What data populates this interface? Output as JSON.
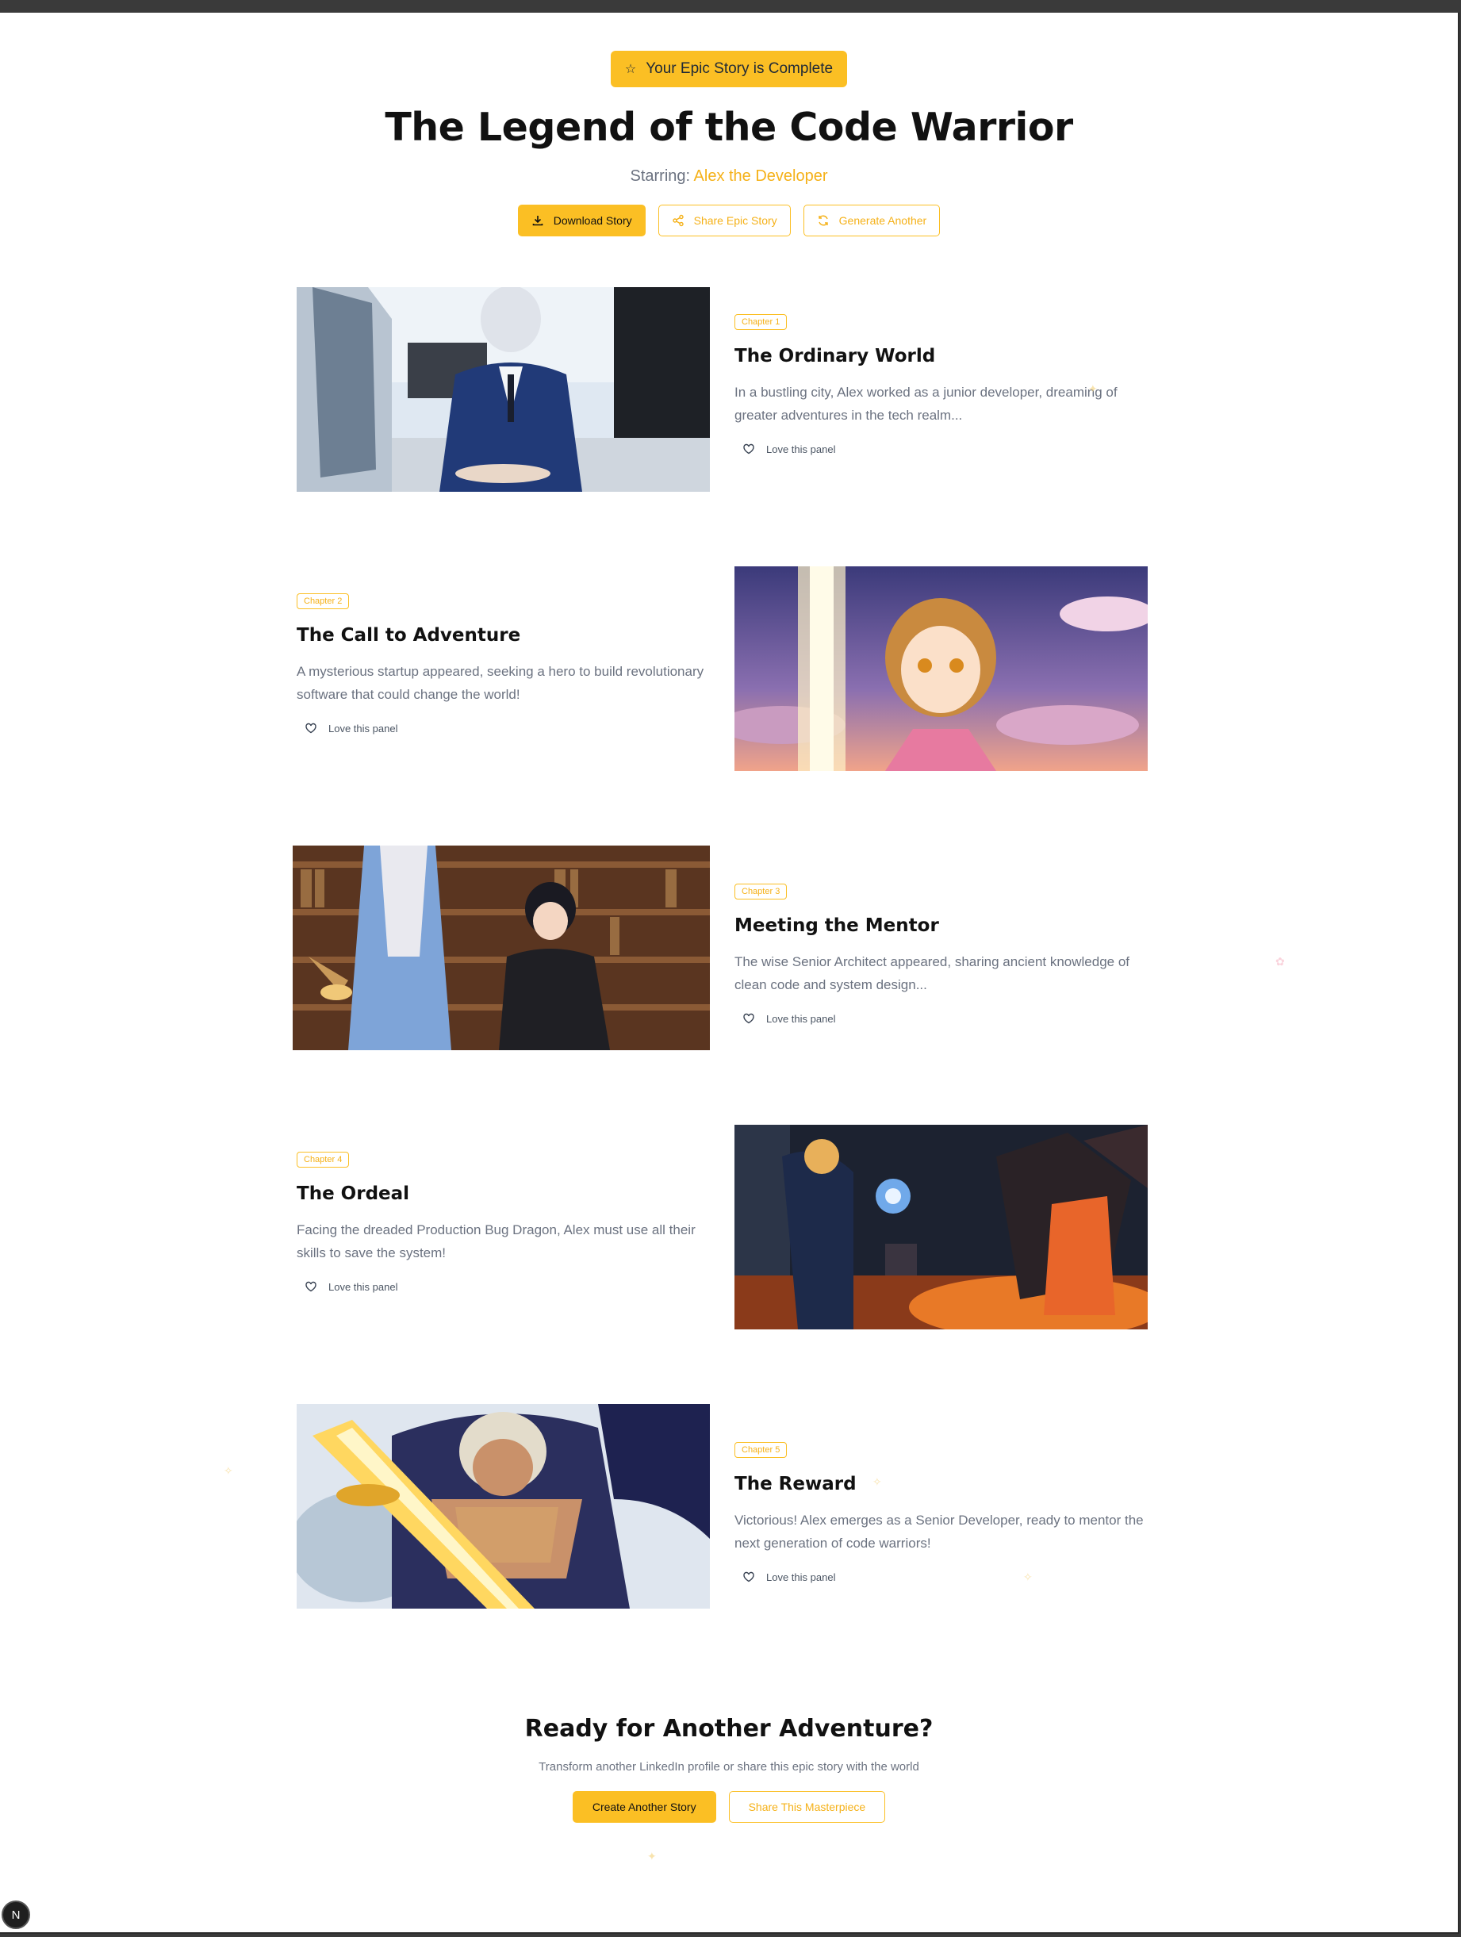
{
  "hero": {
    "badge": "Your Epic Story is Complete",
    "title": "The Legend of the Code Warrior",
    "starring_label": "Starring:",
    "hero_name": "Alex the Developer"
  },
  "actions": {
    "download": "Download Story",
    "share": "Share Epic Story",
    "generate": "Generate Another"
  },
  "chapters": [
    {
      "badge": "Chapter 1",
      "title": "The Ordinary World",
      "description": "In a bustling city, Alex worked as a junior developer, dreaming of greater adventures in the tech realm...",
      "love": "Love this panel"
    },
    {
      "badge": "Chapter 2",
      "title": "The Call to Adventure",
      "description": "A mysterious startup appeared, seeking a hero to build revolutionary software that could change the world!",
      "love": "Love this panel"
    },
    {
      "badge": "Chapter 3",
      "title": "Meeting the Mentor",
      "description": "The wise Senior Architect appeared, sharing ancient knowledge of clean code and system design...",
      "love": "Love this panel"
    },
    {
      "badge": "Chapter 4",
      "title": "The Ordeal",
      "description": "Facing the dreaded Production Bug Dragon, Alex must use all their skills to save the system!",
      "love": "Love this panel"
    },
    {
      "badge": "Chapter 5",
      "title": "The Reward",
      "description": "Victorious! Alex emerges as a Senior Developer, ready to mentor the next generation of code warriors!",
      "love": "Love this panel"
    }
  ],
  "cta": {
    "title": "Ready for Another Adventure?",
    "subtitle": "Transform another LinkedIn profile or share this epic story with the world",
    "create": "Create Another Story",
    "share": "Share This Masterpiece"
  },
  "dev_badge": "N",
  "colors": {
    "accent": "#fbbf24",
    "accent_text": "#f5b118",
    "title": "#111111",
    "muted": "#6b7280"
  }
}
